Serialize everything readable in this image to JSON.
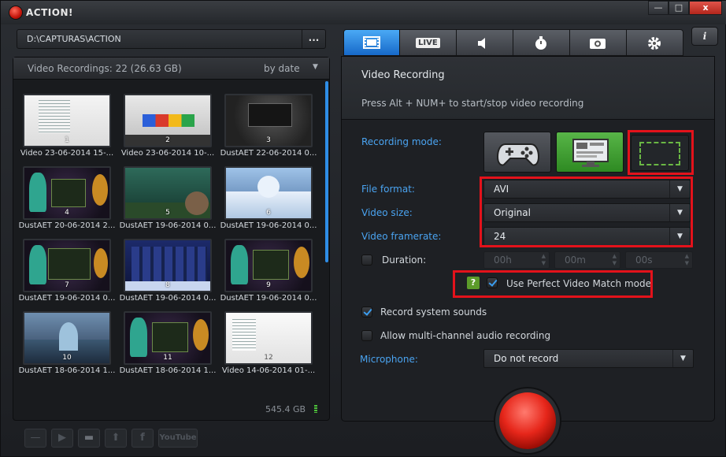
{
  "window": {
    "title": "ACTION!",
    "minimize": "—",
    "maximize": "□",
    "close": "x"
  },
  "path": {
    "value": "D:\\CAPTURAS\\ACTION",
    "browse_label": "..."
  },
  "recordings": {
    "header": "Video Recordings: 22 (26.63 GB)",
    "sort": "by date",
    "disk_free": "545.4 GB",
    "items": [
      {
        "num": "1",
        "caption": "Video 23-06-2014 15-..."
      },
      {
        "num": "2",
        "caption": "Video 23-06-2014 10-..."
      },
      {
        "num": "3",
        "caption": "DustAET 22-06-2014 0..."
      },
      {
        "num": "4",
        "caption": "DustAET 20-06-2014 2..."
      },
      {
        "num": "5",
        "caption": "DustAET 19-06-2014 0..."
      },
      {
        "num": "6",
        "caption": "DustAET 19-06-2014 0..."
      },
      {
        "num": "7",
        "caption": "DustAET 19-06-2014 0..."
      },
      {
        "num": "8",
        "caption": "DustAET 19-06-2014 0..."
      },
      {
        "num": "9",
        "caption": "DustAET 19-06-2014 0..."
      },
      {
        "num": "10",
        "caption": "DustAET 18-06-2014 1..."
      },
      {
        "num": "11",
        "caption": "DustAET 18-06-2014 1..."
      },
      {
        "num": "12",
        "caption": "Video 14-06-2014 01-..."
      }
    ]
  },
  "tabs": {
    "live_label": "LIVE",
    "info_label": "i"
  },
  "video_recording": {
    "title": "Video Recording",
    "hint": "Press Alt + NUM+ to start/stop video recording",
    "recording_mode_label": "Recording mode:",
    "file_format_label": "File format:",
    "file_format_value": "AVI",
    "video_size_label": "Video size:",
    "video_size_value": "Original",
    "video_framerate_label": "Video framerate:",
    "video_framerate_value": "24",
    "duration_label": "Duration:",
    "duration_h": "00h",
    "duration_m": "00m",
    "duration_s": "00s",
    "help_label": "?",
    "perfect_match_label": "Use Perfect Video Match mode",
    "system_sounds_label": "Record system sounds",
    "multichannel_label": "Allow multi-channel audio recording",
    "microphone_label": "Microphone:",
    "microphone_value": "Do not record"
  },
  "bottom_tools": {
    "youtube_label": "YouTube",
    "facebook_label": "f"
  },
  "colors": {
    "accent_blue": "#2e8de6",
    "highlight_red": "#e3121b",
    "record_red": "#e6261a",
    "active_green": "#3d9b2c"
  }
}
